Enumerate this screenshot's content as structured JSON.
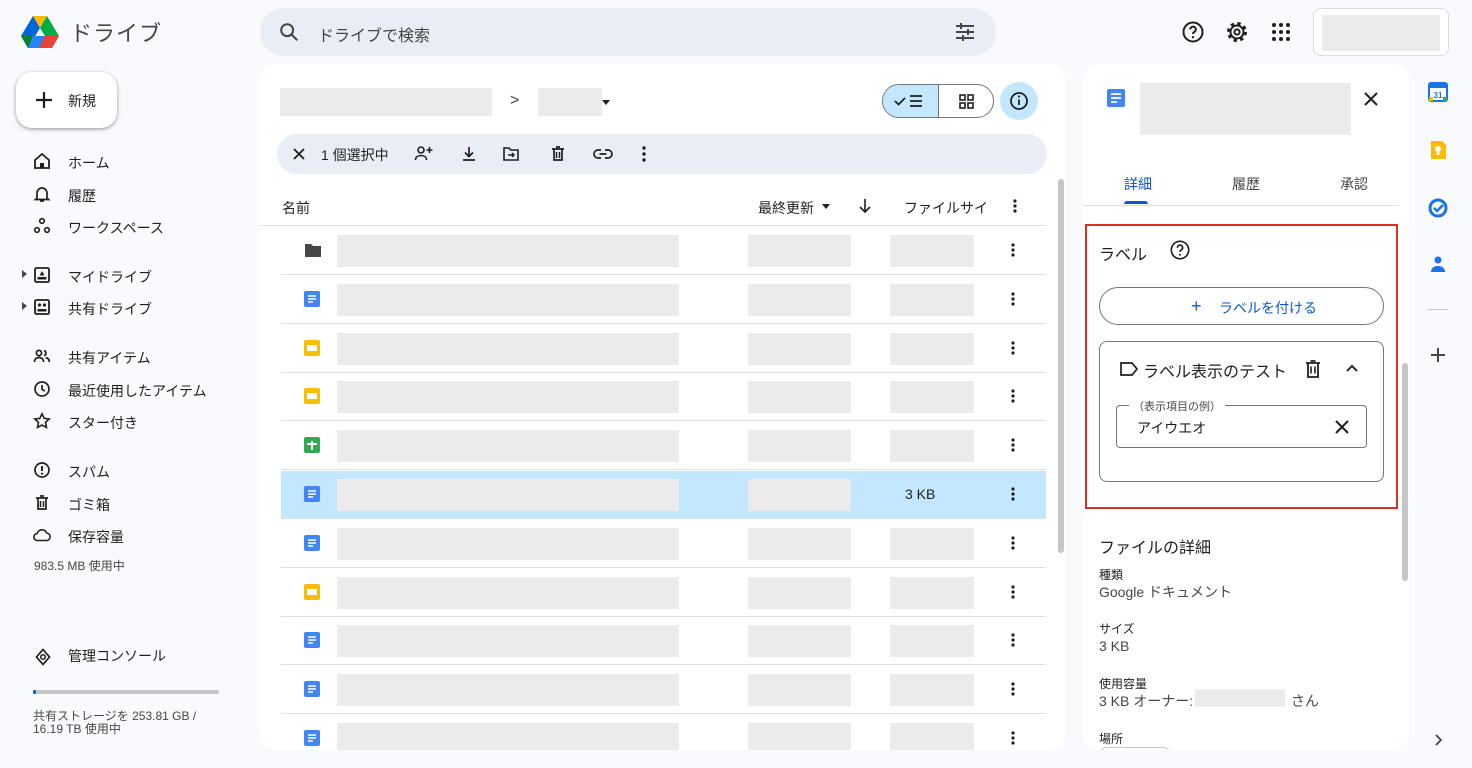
{
  "header": {
    "app_title": "ドライブ",
    "search_placeholder": "ドライブで検索"
  },
  "sidebar": {
    "new_label": "新規",
    "items": [
      {
        "label": "ホーム",
        "icon": "home-icon"
      },
      {
        "label": "履歴",
        "icon": "bell-icon"
      },
      {
        "label": "ワークスペース",
        "icon": "workspace-icon"
      },
      {
        "label": "マイドライブ",
        "icon": "my-drive-icon"
      },
      {
        "label": "共有ドライブ",
        "icon": "shared-drive-icon"
      },
      {
        "label": "共有アイテム",
        "icon": "people-icon"
      },
      {
        "label": "最近使用したアイテム",
        "icon": "clock-icon"
      },
      {
        "label": "スター付き",
        "icon": "star-icon"
      },
      {
        "label": "スパム",
        "icon": "spam-icon"
      },
      {
        "label": "ゴミ箱",
        "icon": "trash-icon"
      },
      {
        "label": "保存容量",
        "icon": "cloud-icon"
      }
    ],
    "storage_used": "983.5 MB 使用中",
    "admin_console": "管理コンソール",
    "shared_storage": "共有ストレージを 253.81 GB / 16.19 TB 使用中",
    "shared_storage_fraction": 0.016
  },
  "main": {
    "breadcrumb_separator": ">",
    "selection_text": "1 個選択中",
    "columns": {
      "name": "名前",
      "modified": "最終更新",
      "size": "ファイルサイ"
    },
    "rows": [
      {
        "type": "folder",
        "size": ""
      },
      {
        "type": "doc",
        "size": ""
      },
      {
        "type": "slides",
        "size": ""
      },
      {
        "type": "slides",
        "size": ""
      },
      {
        "type": "sheets",
        "size": ""
      },
      {
        "type": "doc",
        "size": "3 KB",
        "selected": true
      },
      {
        "type": "doc",
        "size": ""
      },
      {
        "type": "slides",
        "size": ""
      },
      {
        "type": "doc",
        "size": ""
      },
      {
        "type": "doc",
        "size": ""
      },
      {
        "type": "doc",
        "size": ""
      }
    ]
  },
  "details": {
    "tabs": [
      "詳細",
      "履歴",
      "承認"
    ],
    "labels_title": "ラベル",
    "add_label": "ラベルを付ける",
    "label_name": "ラベル表示のテスト",
    "field_legend": "（表示項目の例）",
    "field_value": "アイウエオ",
    "file_details_title": "ファイルの詳細",
    "type_key": "種類",
    "type_value": "Google ドキュメント",
    "size_key": "サイズ",
    "size_value": "3 KB",
    "usage_key": "使用容量",
    "usage_value": "3 KB オーナー:",
    "owner_suffix": "さん",
    "location_key": "場所"
  },
  "colors": {
    "accent": "#0b57d0",
    "selected_bg": "#c2e7ff",
    "highlight_border": "#d93025"
  }
}
